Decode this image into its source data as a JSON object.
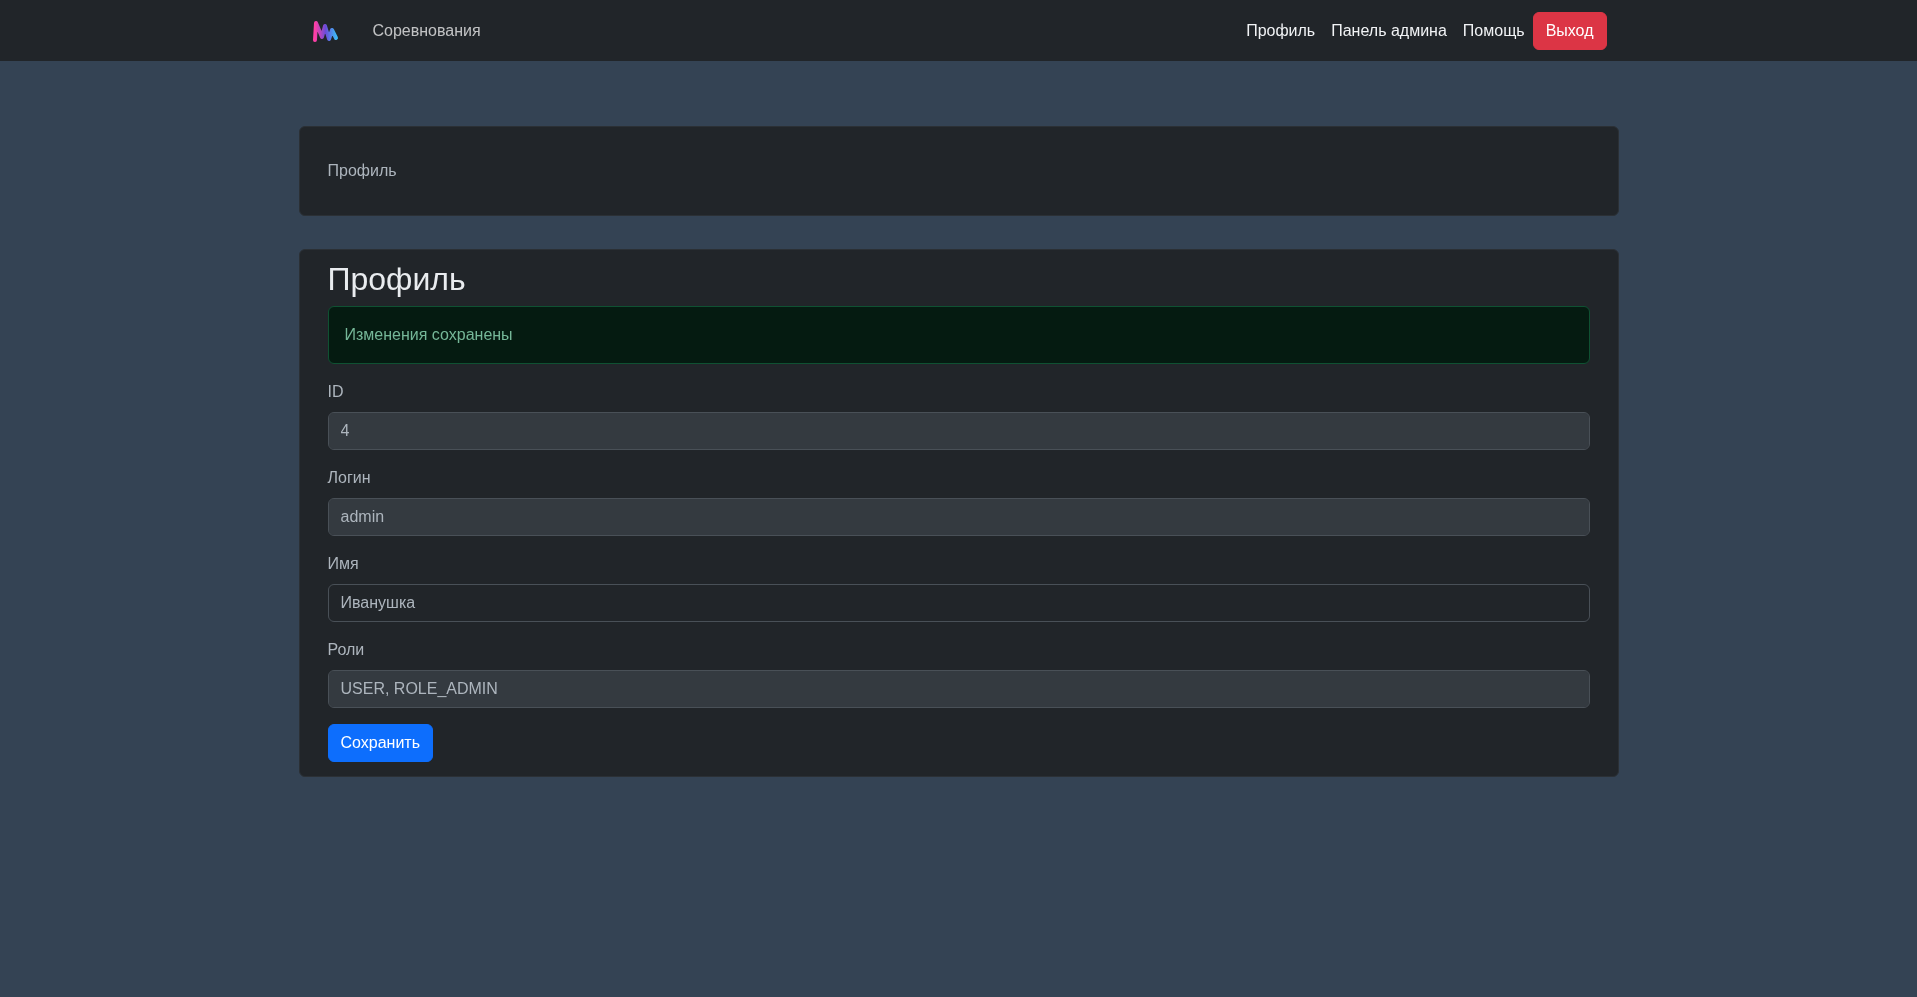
{
  "navbar": {
    "brand": "Соревнования",
    "links": [
      {
        "label": "Профиль"
      },
      {
        "label": "Панель админа"
      },
      {
        "label": "Помощь"
      }
    ],
    "logout_button": "Выход"
  },
  "header_card": {
    "text": "Профиль"
  },
  "profile": {
    "title": "Профиль",
    "alert": "Изменения сохранены",
    "fields": [
      {
        "label": "ID",
        "value": "4",
        "disabled": true
      },
      {
        "label": "Логин",
        "value": "admin",
        "disabled": true
      },
      {
        "label": "Имя",
        "value": "Иванушка",
        "disabled": false
      },
      {
        "label": "Роли",
        "value": "USER, ROLE_ADMIN",
        "disabled": true
      }
    ],
    "save_button": "Сохранить"
  }
}
